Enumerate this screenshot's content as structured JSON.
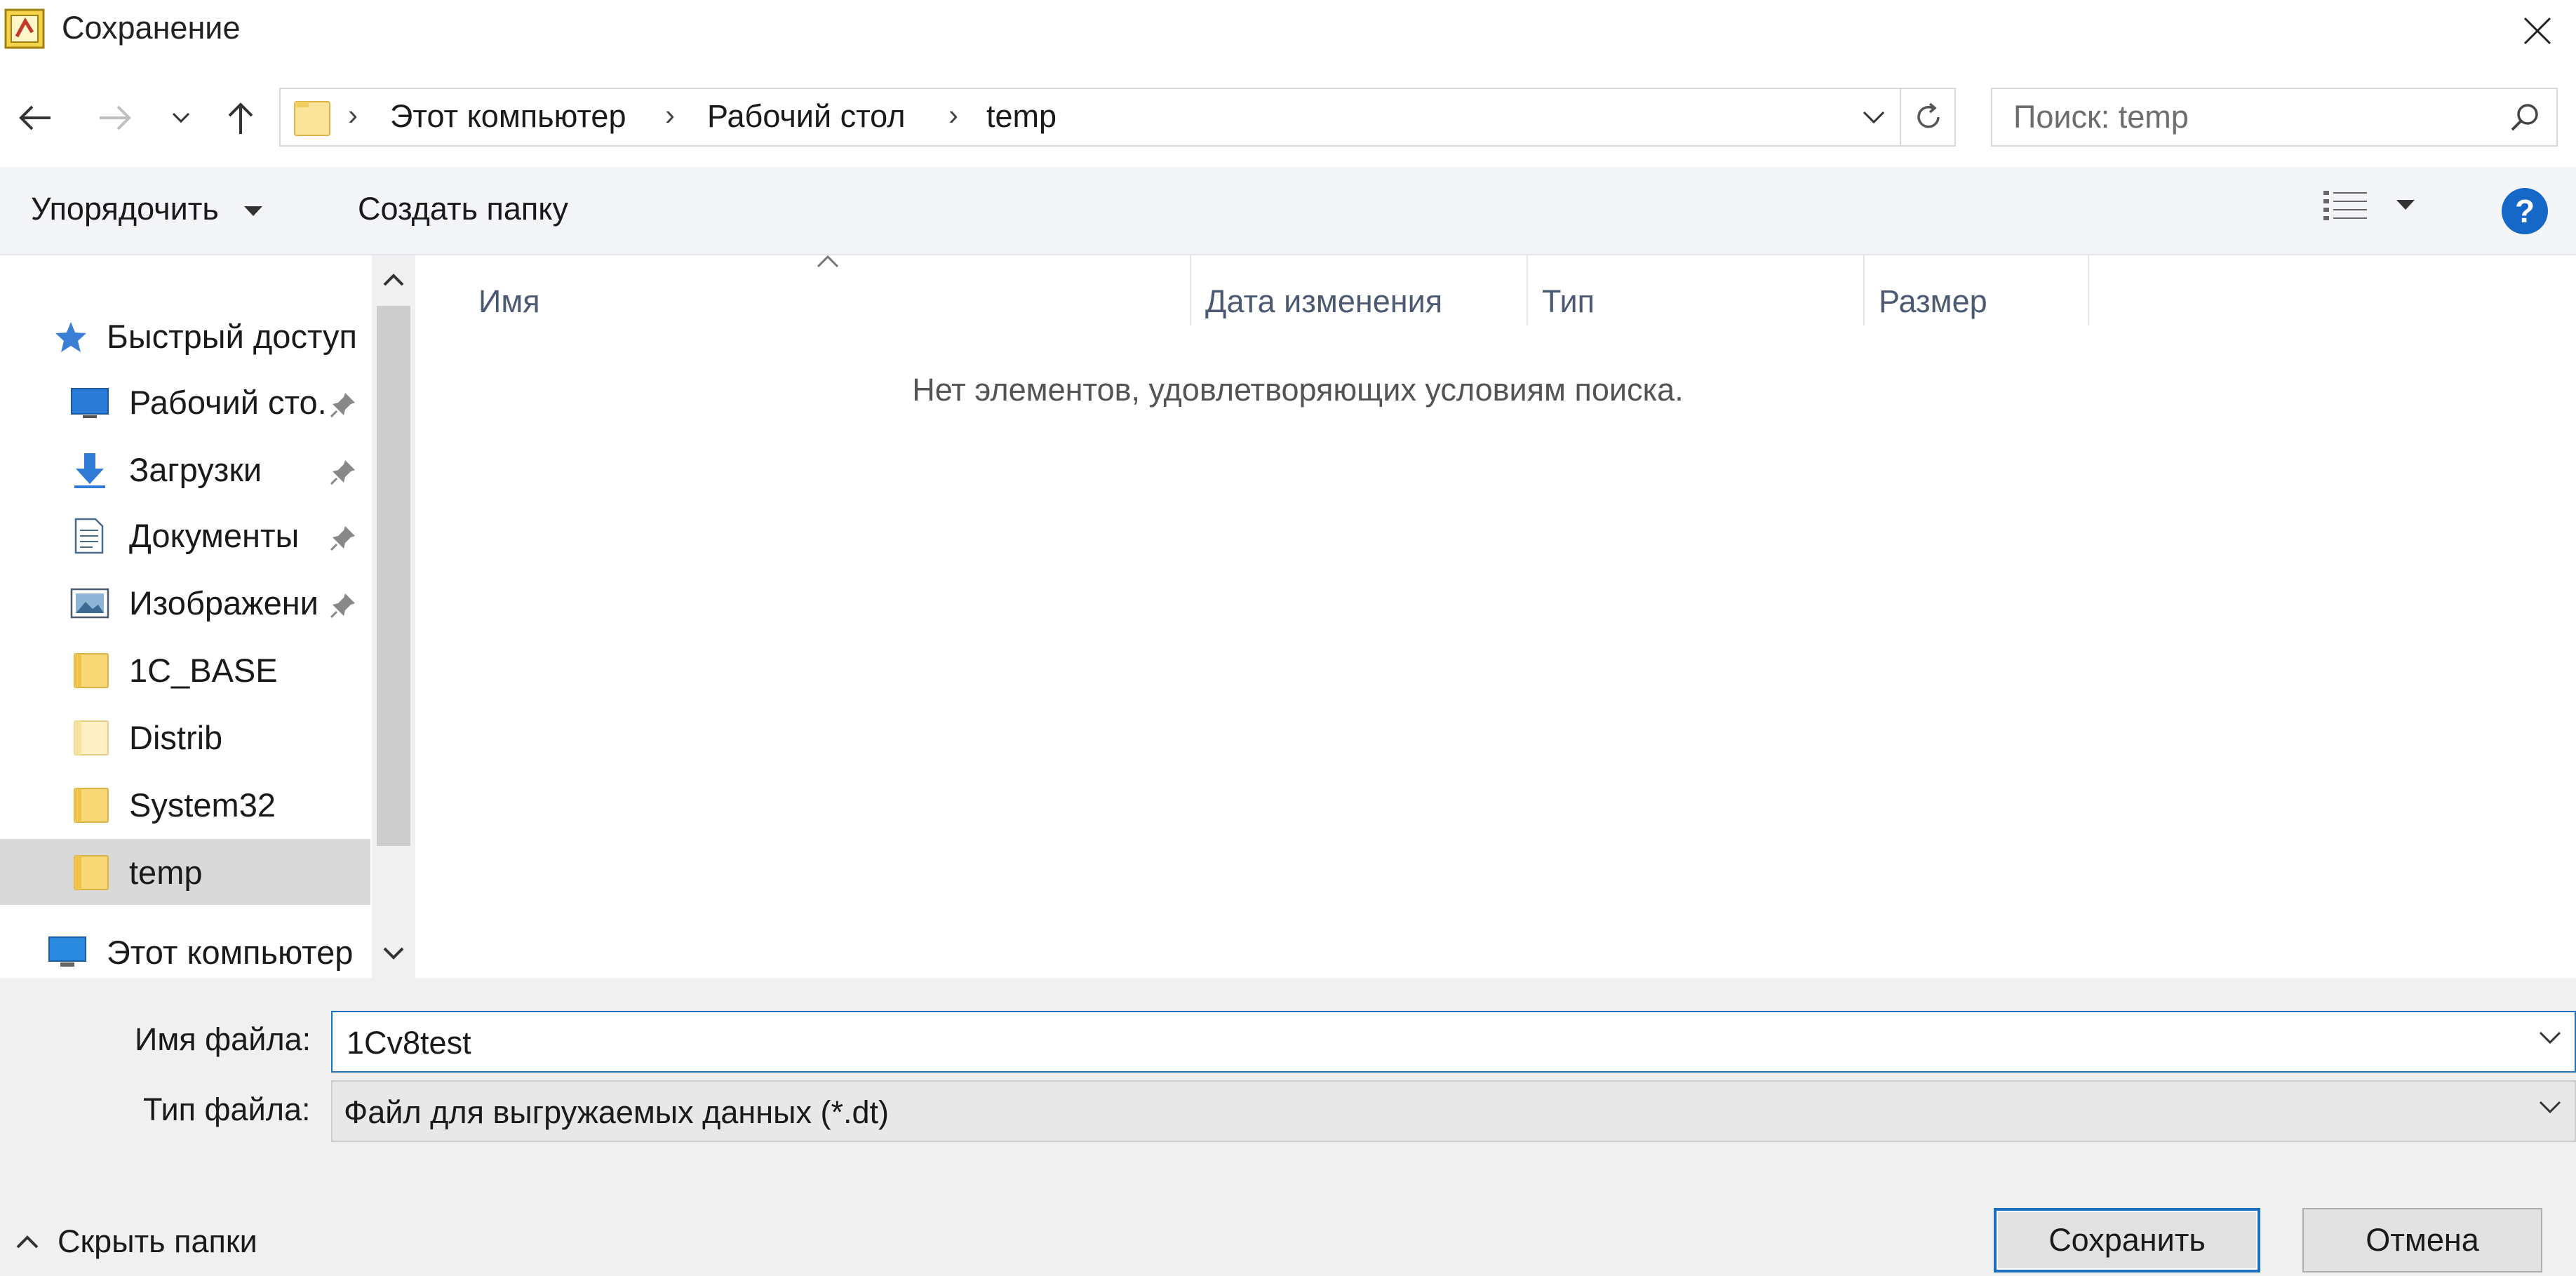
{
  "window": {
    "title": "Сохранение"
  },
  "address_bar": {
    "crumbs": [
      "Этот компьютер",
      "Рабочий стол",
      "temp"
    ],
    "separator": "›"
  },
  "search": {
    "placeholder": "Поиск: temp",
    "value": ""
  },
  "commands": {
    "organize": "Упорядочить",
    "new_folder": "Создать папку",
    "help": "?"
  },
  "navigation": {
    "quick_access": "Быстрый доступ",
    "items": [
      {
        "label": "Рабочий сто.",
        "icon": "desktop-icon",
        "pinned": true
      },
      {
        "label": "Загрузки",
        "icon": "download-icon",
        "pinned": true
      },
      {
        "label": "Документы",
        "icon": "document-icon",
        "pinned": true
      },
      {
        "label": "Изображени",
        "icon": "pictures-icon",
        "pinned": true
      },
      {
        "label": "1C_BASE",
        "icon": "folder-icon",
        "pinned": false
      },
      {
        "label": "Distrib",
        "icon": "folder-icon",
        "pinned": false
      },
      {
        "label": "System32",
        "icon": "folder-icon",
        "pinned": false
      },
      {
        "label": "temp",
        "icon": "folder-icon",
        "pinned": false,
        "selected": true
      }
    ],
    "this_pc": "Этот компьютер"
  },
  "file_list": {
    "columns": [
      "Имя",
      "Дата изменения",
      "Тип",
      "Размер"
    ],
    "empty_message": "Нет элементов, удовлетворяющих условиям поиска."
  },
  "save_form": {
    "filename_label": "Имя файла:",
    "filename_value": "1Cv8test",
    "filetype_label": "Тип файла:",
    "filetype_value": "Файл для выгружаемых данных (*.dt)"
  },
  "footer": {
    "hide_folders": "Скрыть папки",
    "save": "Сохранить",
    "cancel": "Отмена"
  },
  "colors": {
    "accent": "#1f6fbf",
    "help": "#1567c8",
    "folder": "#f8d775",
    "selected_bg": "#d9d9d9"
  }
}
